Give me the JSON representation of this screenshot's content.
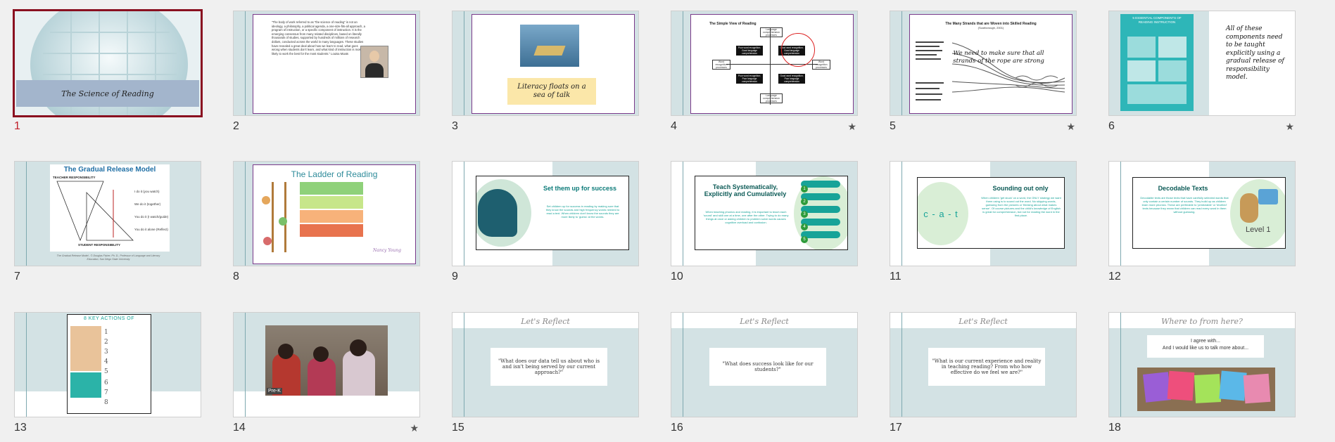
{
  "slides": [
    {
      "number": "1",
      "title": "The Science of Reading",
      "selected": true
    },
    {
      "number": "2",
      "quote": "\"The body of work referred to as \"the science of reading\" is not an ideology, a philosophy, a political agenda, a one-size-fits-all approach, a program of instruction, or a specific component of instruction. It is the emerging consensus from many related disciplines, based on literally thousands of studies, supported by hundreds of millions of research dollars, conducted across the world in many languages. These studies have revealed a great deal about how we learn to read, what goes wrong when students don't learn, and what kind of instruction is most likely to work the best for the most students.\" Louisa Moats"
    },
    {
      "number": "3",
      "caption": "Literacy floats on a sea of talk"
    },
    {
      "number": "4",
      "title": "The Simple View of Reading",
      "starred": true,
      "quadrants": [
        "Poor word recognition; Good language comprehension",
        "Good word recognition; Good language comprehension",
        "Poor word recognition; Poor language comprehension",
        "Good word recognition; Poor language comprehension"
      ],
      "axis_top": "Language comprehension processes",
      "axis_bottom": "Language comprehension processes",
      "axis_left": "Word recognition processes",
      "axis_right": "Word recognition processes"
    },
    {
      "number": "5",
      "title": "The Many Strands that are Woven into Skilled Reading",
      "subtitle": "(Scarborough, 2001)",
      "overlay": "We need to make sure that all strands of the rope are strong",
      "starred": true
    },
    {
      "number": "6",
      "side_title": "5 ESSENTIAL COMPONENTS OF READING INSTRUCTION",
      "text": "All of these components need to be taught explicitly using a gradual release of responsibility model.",
      "starred": true
    },
    {
      "number": "7",
      "title": "The Gradual Release Model",
      "top_label": "TEACHER RESPONSIBILITY",
      "bottom_label": "STUDENT RESPONSIBILITY",
      "steps": [
        "I do it (you watch)",
        "We do it (together)",
        "You do it (I watch/guide)",
        "You do it alone (Reflect)"
      ],
      "caption": "The Gradual Release Model - © Douglas Fisher, Ph. D., Professor of Language and Literacy Education, San Diego State University"
    },
    {
      "number": "8",
      "title": "The Ladder of Reading",
      "credit": "Nancy Young"
    },
    {
      "number": "9",
      "title": "Set them up for success",
      "body": "Set children up for success in reading by making sure that they know the sounds and high frequency words needed to read a text. When children don't know the sounds they are more likely to 'guess' at the words."
    },
    {
      "number": "10",
      "title": "Teach Systematically, Explicitly and Cumulatively",
      "body": "When teaching phonics and reading, it is important to teach each 'sound' and skill one at a time, one after the other. Trying to do many things at once or asking children to problem solve words causes cognitive overload and confusion.",
      "list": [
        "1",
        "2",
        "3",
        "4",
        "5"
      ]
    },
    {
      "number": "11",
      "title": "Sounding out only",
      "word": "c - a - t",
      "body": "When children 'get stuck' on a word, the ONLY strategy we want them using is to sound out the word. No skipping words, guessing from the pictures or 'thinking about what makes sense'. Of course pictures and the child's knowledge of English is great for comprehension, but not for reading the word in the first place."
    },
    {
      "number": "12",
      "title": "Decodable Texts",
      "body": "Decodable texts are those texts that have carefully selected words that only contain a certain number of sounds. They build up as children learn more phonics. These are preferable to 'predictable' or 'levelled' texts because they mean that children can read every word in them without guessing.",
      "badge": "Level 1"
    },
    {
      "number": "13",
      "title": "8 KEY ACTIONS OF",
      "items": [
        "1",
        "2",
        "3",
        "4",
        "5",
        "6",
        "7",
        "8"
      ]
    },
    {
      "number": "14",
      "label": "Pre-K",
      "starred": true
    },
    {
      "number": "15",
      "title": "Let's Reflect",
      "question": "\"What does our data tell us about who is and isn't being served by our current approach?\""
    },
    {
      "number": "16",
      "title": "Let's Reflect",
      "question": "\"What does success look like for our students?\""
    },
    {
      "number": "17",
      "title": "Let's Reflect",
      "question": "\"What is our current experience and reality in teaching reading? From who how effective do we feel we are?\""
    },
    {
      "number": "18",
      "title": "Where to from here?",
      "line1": "I agree with...",
      "line2": "And I would like us to talk more about..."
    }
  ],
  "star_glyph": "★",
  "colors": {
    "selected_border": "#8a1020",
    "teal": "#0b7a78",
    "purple": "#6b2a7a"
  }
}
